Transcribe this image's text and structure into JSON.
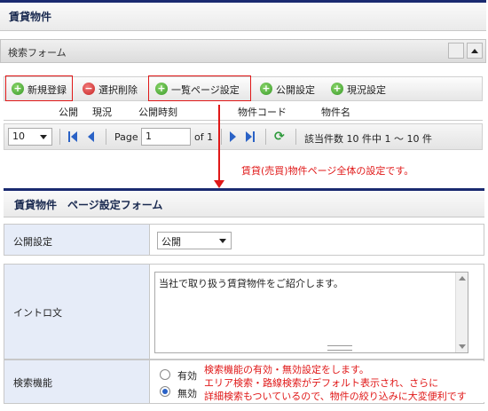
{
  "page_title": "賃貸物件",
  "search_form": {
    "label": "検索フォーム"
  },
  "toolbar": {
    "new_register": "新規登録",
    "select_delete": "選択削除",
    "list_page_settings": "一覧ページ設定",
    "publish_settings": "公開設定",
    "status_settings": "現況設定"
  },
  "table": {
    "columns": [
      "公開",
      "現況",
      "公開時刻",
      "物件コード",
      "物件名"
    ]
  },
  "pager": {
    "page_size": "10",
    "page_label": "Page",
    "page_value": "1",
    "of_label": "of 1",
    "summary": "該当件数  10 件中  1 〜  10 件"
  },
  "annotations": {
    "arrow_note": "賃貸(売買)物件ページ全体の設定です。",
    "search_note_1": "検索機能の有効・無効設定をします。",
    "search_note_2": "エリア検索・路線検索がデフォルト表示され、さらに",
    "search_note_3": "詳細検索もついているので、物件の絞り込みに大変便利です"
  },
  "settings_form": {
    "title": "賃貸物件　ページ設定フォーム",
    "publish_label": "公開設定",
    "publish_value": "公開",
    "intro_label": "イントロ文",
    "intro_value": "当社で取り扱う賃貸物件をご紹介します。",
    "search_label": "検索機能",
    "radio_enabled": "有効",
    "radio_disabled": "無効",
    "radio_selected": "無効"
  },
  "colors": {
    "accent": "#1a2a70",
    "highlight": "#e01818",
    "label_bg": "#e6ecf8"
  }
}
